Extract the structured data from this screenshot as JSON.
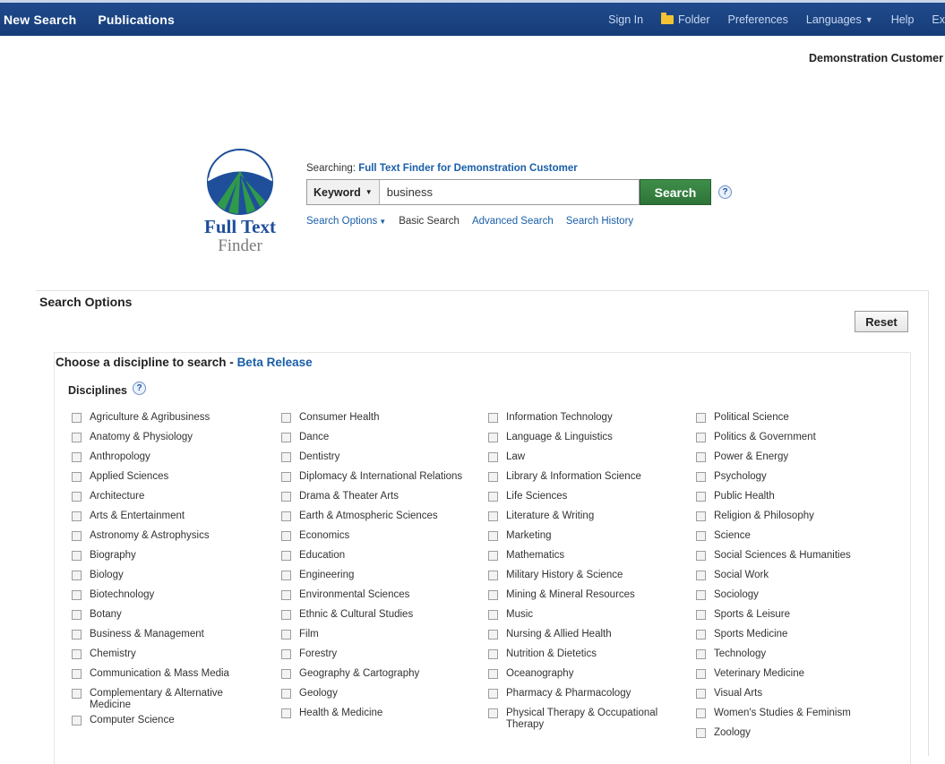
{
  "nav": {
    "left": [
      "New Search",
      "Publications"
    ],
    "sign_in": "Sign In",
    "folder": "Folder",
    "preferences": "Preferences",
    "languages": "Languages",
    "help": "Help",
    "exit": "Ex"
  },
  "customer_name": "Demonstration Customer",
  "logo": {
    "line1": "Full Text",
    "line2": "Finder"
  },
  "searching": {
    "prefix": "Searching:",
    "target": "Full Text Finder for Demonstration Customer"
  },
  "search": {
    "field": "Keyword",
    "query": "business",
    "button": "Search"
  },
  "links": {
    "options": "Search Options",
    "basic": "Basic Search",
    "advanced": "Advanced Search",
    "history": "Search History"
  },
  "options": {
    "title": "Search Options",
    "reset": "Reset",
    "choose": "Choose a discipline to search - ",
    "beta": "Beta Release",
    "disciplines_label": "Disciplines"
  },
  "disciplines": [
    [
      "Agriculture & Agribusiness",
      "Anatomy & Physiology",
      "Anthropology",
      "Applied Sciences",
      "Architecture",
      "Arts & Entertainment",
      "Astronomy & Astrophysics",
      "Biography",
      "Biology",
      "Biotechnology",
      "Botany",
      "Business & Management",
      "Chemistry",
      "Communication & Mass Media",
      "Complementary & Alternative Medicine",
      "Computer Science"
    ],
    [
      "Consumer Health",
      "Dance",
      "Dentistry",
      "Diplomacy & International Relations",
      "Drama & Theater Arts",
      "Earth & Atmospheric Sciences",
      "Economics",
      "Education",
      "Engineering",
      "Environmental Sciences",
      "Ethnic & Cultural Studies",
      "Film",
      "Forestry",
      "Geography & Cartography",
      "Geology",
      "Health & Medicine"
    ],
    [
      "Information Technology",
      "Language & Linguistics",
      "Law",
      "Library & Information Science",
      "Life Sciences",
      "Literature & Writing",
      "Marketing",
      "Mathematics",
      "Military History & Science",
      "Mining & Mineral Resources",
      "Music",
      "Nursing & Allied Health",
      "Nutrition & Dietetics",
      "Oceanography",
      "Pharmacy & Pharmacology",
      "Physical Therapy & Occupational Therapy"
    ],
    [
      "Political Science",
      "Politics & Government",
      "Power & Energy",
      "Psychology",
      "Public Health",
      "Religion & Philosophy",
      "Science",
      "Social Sciences & Humanities",
      "Social Work",
      "Sociology",
      "Sports & Leisure",
      "Sports Medicine",
      "Technology",
      "Veterinary Medicine",
      "Visual Arts",
      "Women's Studies & Feminism",
      "Zoology"
    ]
  ]
}
